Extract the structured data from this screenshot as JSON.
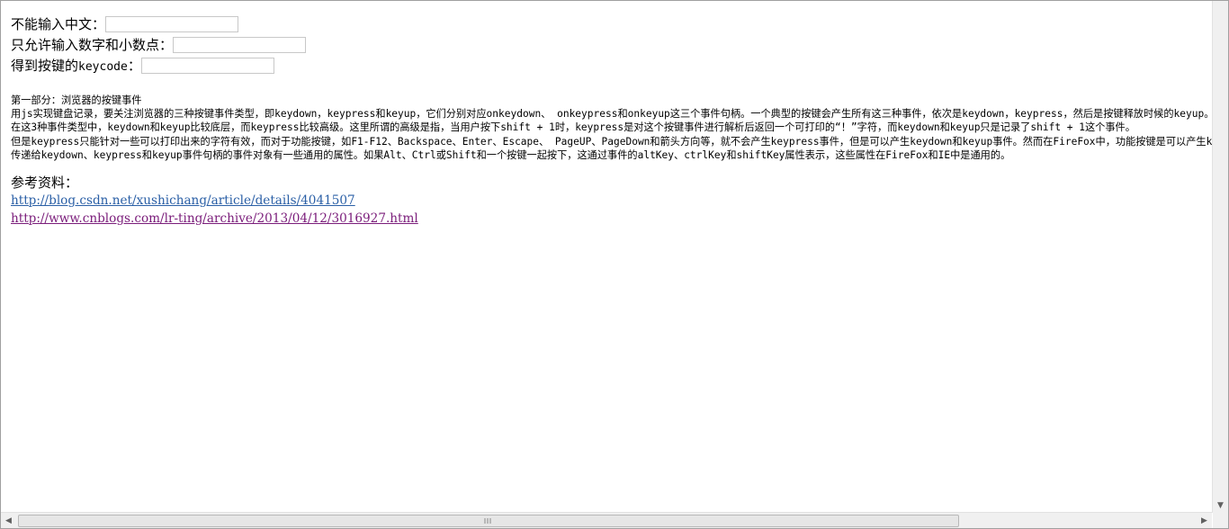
{
  "form": {
    "row1_label": "不能输入中文：",
    "row2_label": "只允许输入数字和小数点：",
    "row3_label_prefix": "得到按键的",
    "row3_label_code": "keycode",
    "row3_label_suffix": "："
  },
  "section": {
    "heading": "第一部分：浏览器的按键事件",
    "lines": [
      "用js实现键盘记录，要关注浏览器的三种按键事件类型，即keydown，keypress和keyup，它们分别对应onkeydown、 onkeypress和onkeyup这三个事件句柄。一个典型的按键会产生所有这三种事件，依次是keydown，keypress，然后是按键释放时候的keyup。",
      "在这3种事件类型中，keydown和keyup比较底层，而keypress比较高级。这里所谓的高级是指，当用户按下shift + 1时，keypress是对这个按键事件进行解析后返回一个可打印的“！”字符，而keydown和keyup只是记录了shift + 1这个事件。",
      "但是keypress只能针对一些可以打印出来的字符有效，而对于功能按键，如F1-F12、Backspace、Enter、Escape、 PageUP、PageDown和箭头方向等，就不会产生keypress事件，但是可以产生keydown和keyup事件。然而在FireFox中，功能按键是可以产生keypress事件的。",
      "传递给keydown、keypress和keyup事件句柄的事件对象有一些通用的属性。如果Alt、Ctrl或Shift和一个按键一起按下，这通过事件的altKey、ctrlKey和shiftKey属性表示，这些属性在FireFox和IE中是通用的。"
    ]
  },
  "refs": {
    "title": "参考资料：",
    "link1": "http://blog.csdn.net/xushichang/article/details/4041507",
    "link2": "http://www.cnblogs.com/lr-ting/archive/2013/04/12/3016927.html"
  },
  "icons": {
    "scroll_down": "▼",
    "scroll_left": "◀",
    "scroll_right": "▶"
  }
}
